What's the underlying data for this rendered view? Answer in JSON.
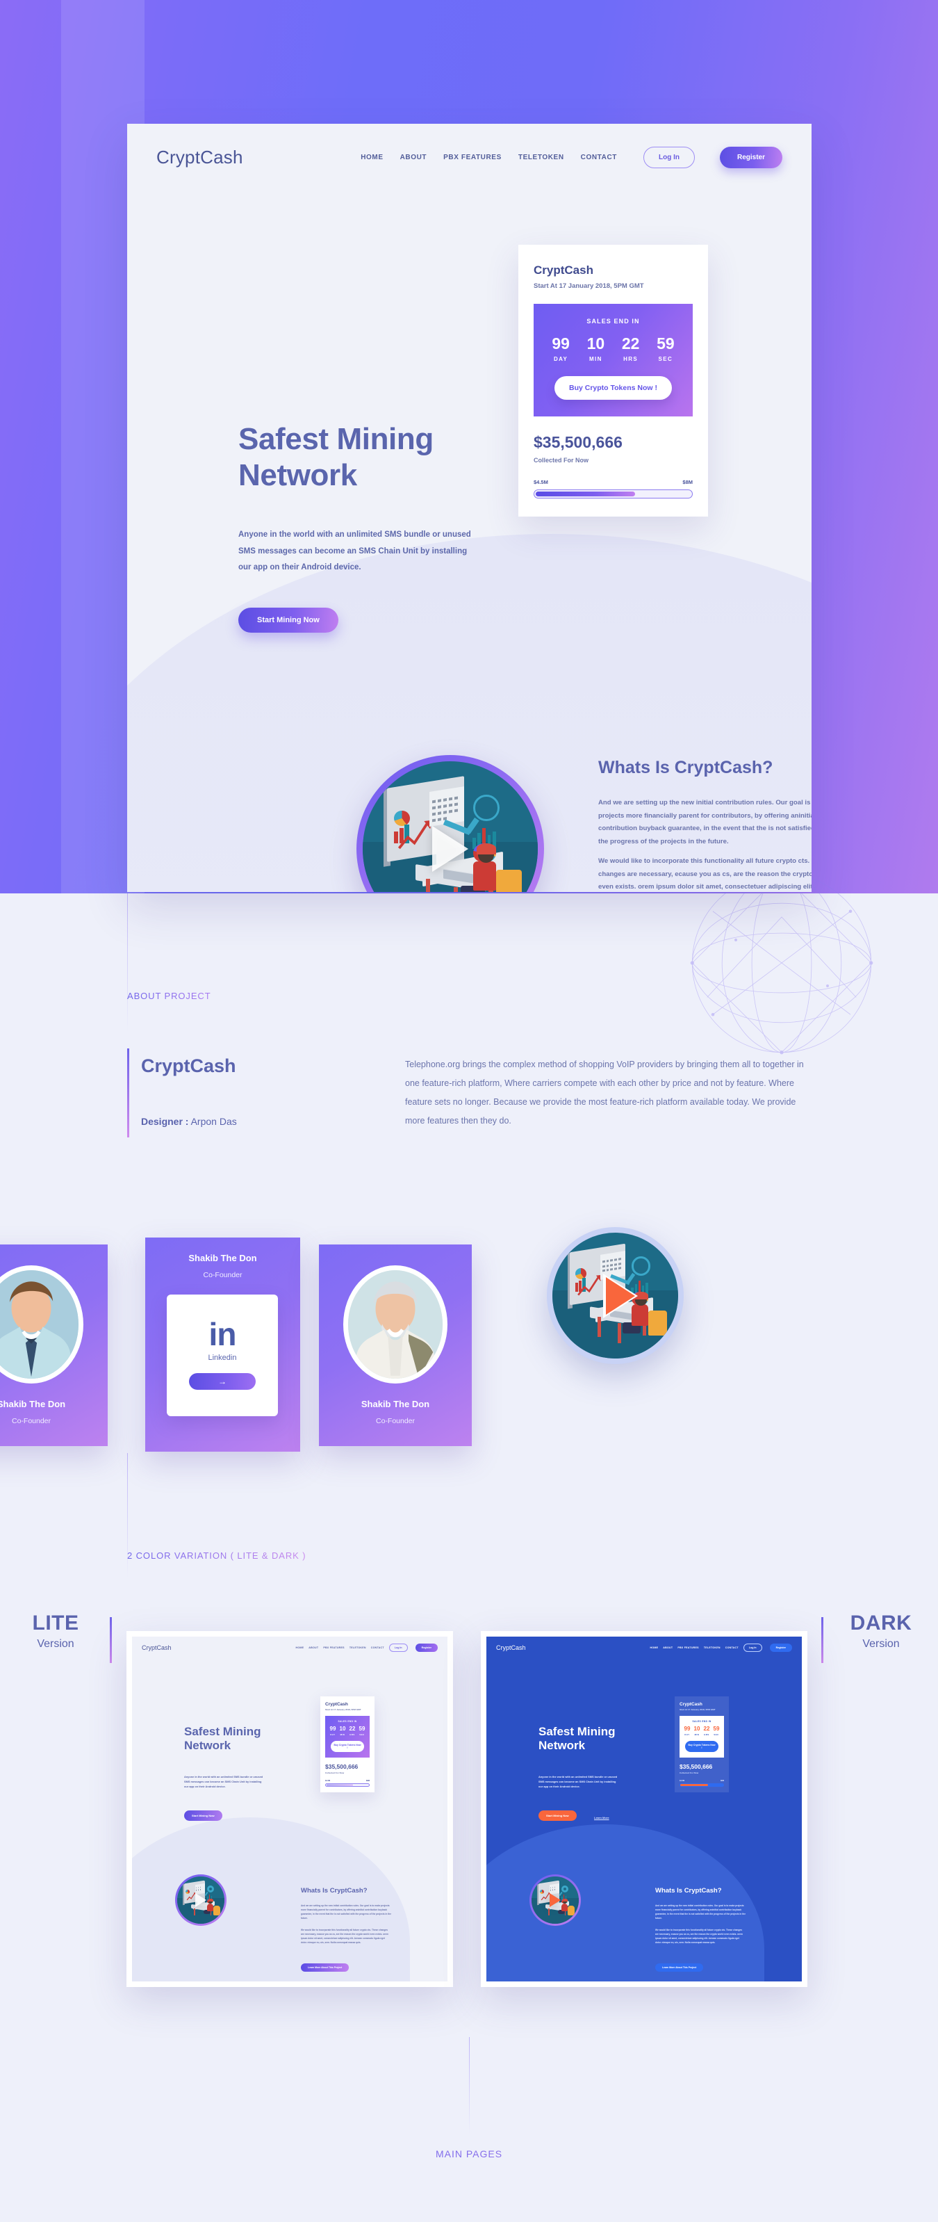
{
  "site": {
    "brand": "CryptCash",
    "nav": [
      {
        "label": "HOME"
      },
      {
        "label": "ABOUT"
      },
      {
        "label": "PBX FEATURES"
      },
      {
        "label": "TELETOKEN"
      },
      {
        "label": "CONTACT"
      }
    ],
    "login_label": "Log In",
    "register_label": "Register"
  },
  "hero": {
    "title": "Safest Mining Network",
    "subtitle": "Anyone in the world with an unlimited SMS bundle or unused SMS messages can become an SMS Chain Unit by installing our app on their Android device.",
    "cta_label": "Start Mining Now",
    "cta_secondary_label": "Learn More"
  },
  "ico_card": {
    "title": "CryptCash",
    "date": "Start At  17 January 2018,  5PM GMT",
    "sales_end_label": "SALES END IN",
    "countdown": [
      {
        "value": "99",
        "unit": "DAY"
      },
      {
        "value": "10",
        "unit": "MIN"
      },
      {
        "value": "22",
        "unit": "HRS"
      },
      {
        "value": "59",
        "unit": "SEC"
      }
    ],
    "buy_label": "Buy Crypto Tokens Now !",
    "amount": "$35,500,666",
    "amount_caption": "Collected For Now",
    "range_min": "$4.5M",
    "range_max": "$8M",
    "progress_percent": 64
  },
  "whats_is": {
    "title": "Whats Is CryptCash?",
    "paragraph1": "And we are setting up the new initial contribution rules. Our goal is to make projects more financially parent for contributors, by offering aninitial contribution buyback guarantee, in the event that the is not satisfied with the progress of the projects in the future.",
    "paragraph2": "We would like to incorporate this functionality all future crypto cts. These changes are necessary, ecause you as cs, are the reason the crypto world even exists. orem ipsum dolor sit amet, consectetuer adipiscing elit. Aenean commodo ligula eget dolor. ntesque eu, uis, sem. Nulla consequat massa quis.",
    "cta_label": "Learn More About This Project"
  },
  "about": {
    "section_label": "ABOUT PROJECT",
    "project_name": "CryptCash",
    "designer_label": "Designer :",
    "designer_name": "Arpon Das",
    "body": "Telephone.org brings the complex method of shopping VoIP providers by bringing them all to together in one feature-rich platform, Where carriers compete with each other by price and not by feature. Where feature sets no longer. Because we provide the most feature-rich platform available today. We provide more features then they do."
  },
  "team": {
    "members": [
      {
        "name": "Shakib The Don",
        "role": "Co-Founder"
      },
      {
        "name": "Shakib The Don",
        "role": "Co-Founder"
      },
      {
        "name": "Shakib The Don",
        "role": "Co-Founder"
      }
    ],
    "linkedin": {
      "glyph": "in",
      "label": "Linkedin",
      "button_glyph": "→"
    }
  },
  "variations": {
    "section_label": "2 COLOR VARIATION ( LITE & DARK )",
    "lite": {
      "big": "LITE",
      "small": "Version"
    },
    "dark": {
      "big": "DARK",
      "small": "Version"
    }
  },
  "footer": {
    "main_pages_label": "MAIN PAGES"
  },
  "colors": {
    "purple": "#6f63ea",
    "purple_light": "#8b6cf6",
    "magenta": "#c07ff0",
    "ink": "#5a63ad",
    "muted": "#6b74ac",
    "dark_blue": "#2b50c4",
    "orange": "#f9663c",
    "page_bg": "#eef0fa"
  }
}
